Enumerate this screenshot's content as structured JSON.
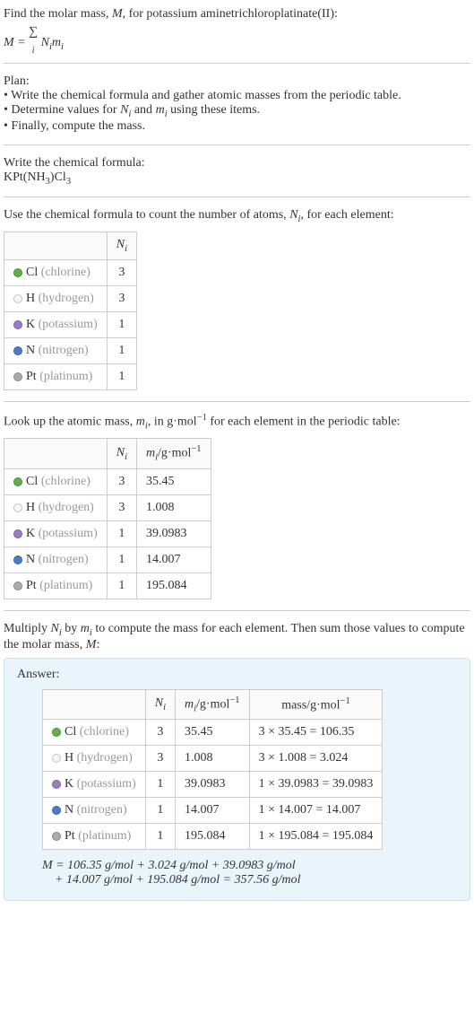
{
  "intro": {
    "line1_pre": "Find the molar mass, ",
    "line1_var": "M",
    "line1_post": ", for potassium aminetrichloroplatinate(II):",
    "formula_lhs": "M = ",
    "formula_sum": "∑",
    "formula_idx": "i",
    "formula_rhs_a": " N",
    "formula_rhs_b": "m"
  },
  "plan": {
    "title": "Plan:",
    "b1": "• Write the chemical formula and gather atomic masses from the periodic table.",
    "b2_a": "• Determine values for ",
    "b2_n": "N",
    "b2_and": " and ",
    "b2_m": "m",
    "b2_b": " using these items.",
    "b3": "• Finally, compute the mass."
  },
  "chem": {
    "prompt": "Write the chemical formula:",
    "f1": "KPt(NH",
    "f2": "3",
    "f3": ")Cl",
    "f4": "3"
  },
  "count": {
    "prompt_a": "Use the chemical formula to count the number of atoms, ",
    "prompt_var": "N",
    "prompt_b": ", for each element:",
    "hdr_n": "N",
    "hdr_i": "i"
  },
  "lookup": {
    "prompt_a": "Look up the atomic mass, ",
    "prompt_var": "m",
    "prompt_b": ", in g·mol",
    "prompt_exp": "−1",
    "prompt_c": " for each element in the periodic table:",
    "hdr_m_a": "m",
    "hdr_m_unit": "/g·mol",
    "hdr_m_exp": "−1"
  },
  "multiply": {
    "p_a": "Multiply ",
    "p_n": "N",
    "p_by": " by ",
    "p_m": "m",
    "p_b": " to compute the mass for each element. Then sum those values to compute the molar mass, ",
    "p_M": "M",
    "p_c": ":"
  },
  "answer": {
    "label": "Answer:",
    "hdr_mass": "mass/g·mol",
    "hdr_exp": "−1",
    "sum_a": "M",
    "sum_b": " = 106.35 g/mol + 3.024 g/mol + 39.0983 g/mol",
    "sum_c": "+ 14.007 g/mol + 195.084 g/mol = 357.56 g/mol"
  },
  "elements": {
    "cl": {
      "sym": "Cl",
      "name": "(chlorine)",
      "n": "3",
      "m": "35.45",
      "mass": "3 × 35.45 = 106.35"
    },
    "h": {
      "sym": "H",
      "name": "(hydrogen)",
      "n": "3",
      "m": "1.008",
      "mass": "3 × 1.008 = 3.024"
    },
    "k": {
      "sym": "K",
      "name": "(potassium)",
      "n": "1",
      "m": "39.0983",
      "mass": "1 × 39.0983 = 39.0983"
    },
    "n": {
      "sym": "N",
      "name": "(nitrogen)",
      "n": "1",
      "m": "14.007",
      "mass": "1 × 14.007 = 14.007"
    },
    "pt": {
      "sym": "Pt",
      "name": "(platinum)",
      "n": "1",
      "m": "195.084",
      "mass": "1 × 195.084 = 195.084"
    }
  }
}
